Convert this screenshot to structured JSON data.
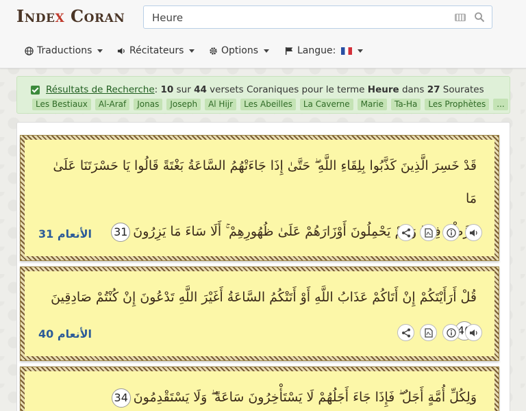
{
  "logo": {
    "part1": "Inde",
    "x": "x",
    "part2": "Coran"
  },
  "search": {
    "value": "Heure"
  },
  "nav": {
    "translations": "Traductions",
    "reciters": "Récitateurs",
    "options": "Options",
    "language": "Langue:"
  },
  "results": {
    "link": "Résultats de Recherche",
    "colon": ":",
    "count": "10",
    "sur": "sur",
    "total": "44",
    "text1": "versets Coraniques pour le terme",
    "term": "Heure",
    "text2": "dans",
    "surahs": "27",
    "text3": "Sourates",
    "chips": [
      "Les Bestiaux",
      "Al-Araf",
      "Jonas",
      "Joseph",
      "Al Hijr",
      "Les Abeilles",
      "La Caverne",
      "Marie",
      "Ta-Ha",
      "Les Prophètes",
      "..."
    ]
  },
  "verses": [
    {
      "line1": "قَدْ خَسِرَ الَّذِينَ كَذَّبُوا بِلِقَاءِ اللَّهِ ۖ حَتَّىٰ إِذَا جَاءَتْهُمُ السَّاعَةُ بَغْتَةً قَالُوا يَا حَسْرَتَنَا عَلَىٰ مَا",
      "line2": "فَرَّطْنَا فِيهَا وَهُمْ يَحْمِلُونَ أَوْزَارَهُمْ عَلَىٰ ظُهُورِهِمْ ۚ أَلَا سَاءَ مَا يَزِرُونَ",
      "number": "31",
      "reference": "الأنعام 31"
    },
    {
      "line1": "قُلْ أَرَأَيْتَكُمْ إِنْ أَتَاكُمْ عَذَابُ اللَّهِ أَوْ أَتَتْكُمُ السَّاعَةُ أَغَيْرَ اللَّهِ تَدْعُونَ إِنْ كُنْتُمْ صَادِقِينَ",
      "number": "40",
      "reference": "الأنعام 40"
    },
    {
      "line1": "وَلِكُلِّ أُمَّةٍ أَجَلٌ ۖ فَإِذَا جَاءَ أَجَلُهُمْ لَا يَسْتَأْخِرُونَ سَاعَةً ۖ وَلَا يَسْتَقْدِمُونَ",
      "number": "34"
    }
  ],
  "icons": [
    "globe-icon",
    "speaker-icon",
    "gear-icon",
    "flag-icon",
    "search-icon",
    "keyboard-icon",
    "share-icon",
    "pdf-icon",
    "info-icon",
    "volume-icon"
  ],
  "colors": {
    "logo": "#4a3526",
    "accent": "#c0392b",
    "verse_bg": "#fcf7a8",
    "reference": "#2b5b98",
    "results_bg": "#dff0d8"
  }
}
